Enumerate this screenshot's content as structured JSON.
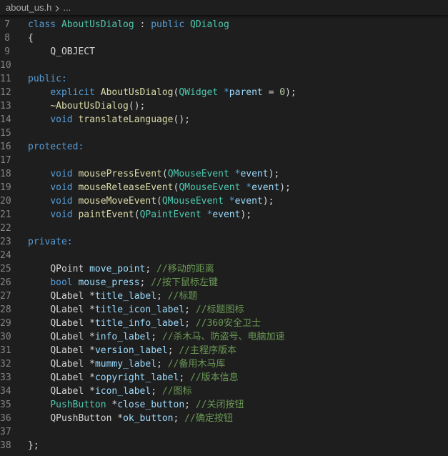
{
  "breadcrumb": {
    "file": "about_us.h",
    "more": "..."
  },
  "colors": {
    "background": "#1e1e1e",
    "keyword": "#569cd6",
    "type": "#4ec9b0",
    "function": "#dcdcaa",
    "variable": "#9cdcfe",
    "number": "#b5cea8",
    "comment": "#6a9955",
    "plain": "#d4d4d4",
    "line_number": "#858585"
  },
  "lines": [
    {
      "n": "7",
      "tokens": [
        [
          "kw",
          "class"
        ],
        [
          "pl",
          " "
        ],
        [
          "ty",
          "AboutUsDialog"
        ],
        [
          "pl",
          " : "
        ],
        [
          "kw",
          "public"
        ],
        [
          "pl",
          " "
        ],
        [
          "ty",
          "QDialog"
        ]
      ]
    },
    {
      "n": "8",
      "tokens": [
        [
          "pl",
          "{"
        ]
      ]
    },
    {
      "n": "9",
      "tokens": [
        [
          "pl",
          "    "
        ],
        [
          "pl",
          "Q_OBJECT"
        ]
      ]
    },
    {
      "n": "10",
      "tokens": []
    },
    {
      "n": "11",
      "tokens": [
        [
          "kw",
          "public:"
        ]
      ]
    },
    {
      "n": "12",
      "tokens": [
        [
          "pl",
          "    "
        ],
        [
          "kw",
          "explicit"
        ],
        [
          "pl",
          " "
        ],
        [
          "fn",
          "AboutUsDialog"
        ],
        [
          "pl",
          "("
        ],
        [
          "ty",
          "QWidget"
        ],
        [
          "pl",
          " "
        ],
        [
          "kw",
          "*"
        ],
        [
          "var",
          "parent"
        ],
        [
          "pl",
          " = "
        ],
        [
          "num",
          "0"
        ],
        [
          "pl",
          ");"
        ]
      ]
    },
    {
      "n": "13",
      "tokens": [
        [
          "pl",
          "    "
        ],
        [
          "fn",
          "~AboutUsDialog"
        ],
        [
          "pl",
          "();"
        ]
      ]
    },
    {
      "n": "14",
      "tokens": [
        [
          "pl",
          "    "
        ],
        [
          "kw",
          "void"
        ],
        [
          "pl",
          " "
        ],
        [
          "fn",
          "translateLanguage"
        ],
        [
          "pl",
          "();"
        ]
      ]
    },
    {
      "n": "15",
      "tokens": []
    },
    {
      "n": "16",
      "tokens": [
        [
          "kw",
          "protected:"
        ]
      ]
    },
    {
      "n": "17",
      "tokens": []
    },
    {
      "n": "18",
      "tokens": [
        [
          "pl",
          "    "
        ],
        [
          "kw",
          "void"
        ],
        [
          "pl",
          " "
        ],
        [
          "fn",
          "mousePressEvent"
        ],
        [
          "pl",
          "("
        ],
        [
          "ty",
          "QMouseEvent"
        ],
        [
          "pl",
          " "
        ],
        [
          "kw",
          "*"
        ],
        [
          "var",
          "event"
        ],
        [
          "pl",
          ");"
        ]
      ]
    },
    {
      "n": "19",
      "tokens": [
        [
          "pl",
          "    "
        ],
        [
          "kw",
          "void"
        ],
        [
          "pl",
          " "
        ],
        [
          "fn",
          "mouseReleaseEvent"
        ],
        [
          "pl",
          "("
        ],
        [
          "ty",
          "QMouseEvent"
        ],
        [
          "pl",
          " "
        ],
        [
          "kw",
          "*"
        ],
        [
          "var",
          "event"
        ],
        [
          "pl",
          ");"
        ]
      ]
    },
    {
      "n": "20",
      "tokens": [
        [
          "pl",
          "    "
        ],
        [
          "kw",
          "void"
        ],
        [
          "pl",
          " "
        ],
        [
          "fn",
          "mouseMoveEvent"
        ],
        [
          "pl",
          "("
        ],
        [
          "ty",
          "QMouseEvent"
        ],
        [
          "pl",
          " "
        ],
        [
          "kw",
          "*"
        ],
        [
          "var",
          "event"
        ],
        [
          "pl",
          ");"
        ]
      ]
    },
    {
      "n": "21",
      "tokens": [
        [
          "pl",
          "    "
        ],
        [
          "kw",
          "void"
        ],
        [
          "pl",
          " "
        ],
        [
          "fn",
          "paintEvent"
        ],
        [
          "pl",
          "("
        ],
        [
          "ty",
          "QPaintEvent"
        ],
        [
          "pl",
          " "
        ],
        [
          "kw",
          "*"
        ],
        [
          "var",
          "event"
        ],
        [
          "pl",
          ");"
        ]
      ]
    },
    {
      "n": "22",
      "tokens": []
    },
    {
      "n": "23",
      "tokens": [
        [
          "kw",
          "private:"
        ]
      ]
    },
    {
      "n": "24",
      "tokens": []
    },
    {
      "n": "25",
      "tokens": [
        [
          "pl",
          "    "
        ],
        [
          "pl",
          "QPoint"
        ],
        [
          "pl",
          " "
        ],
        [
          "var",
          "move_point"
        ],
        [
          "pl",
          "; "
        ],
        [
          "cm",
          "//移动的距离"
        ]
      ]
    },
    {
      "n": "26",
      "tokens": [
        [
          "pl",
          "    "
        ],
        [
          "kw",
          "bool"
        ],
        [
          "pl",
          " "
        ],
        [
          "var",
          "mouse_press"
        ],
        [
          "pl",
          "; "
        ],
        [
          "cm",
          "//按下鼠标左键"
        ]
      ]
    },
    {
      "n": "27",
      "tokens": [
        [
          "pl",
          "    "
        ],
        [
          "pl",
          "QLabel"
        ],
        [
          "pl",
          " *"
        ],
        [
          "var",
          "title_label"
        ],
        [
          "pl",
          "; "
        ],
        [
          "cm",
          "//标题"
        ]
      ]
    },
    {
      "n": "28",
      "tokens": [
        [
          "pl",
          "    "
        ],
        [
          "pl",
          "QLabel"
        ],
        [
          "pl",
          " *"
        ],
        [
          "var",
          "title_icon_label"
        ],
        [
          "pl",
          "; "
        ],
        [
          "cm",
          "//标题图标"
        ]
      ]
    },
    {
      "n": "29",
      "tokens": [
        [
          "pl",
          "    "
        ],
        [
          "pl",
          "QLabel"
        ],
        [
          "pl",
          " *"
        ],
        [
          "var",
          "title_info_label"
        ],
        [
          "pl",
          "; "
        ],
        [
          "cm",
          "//360安全卫士"
        ]
      ]
    },
    {
      "n": "30",
      "tokens": [
        [
          "pl",
          "    "
        ],
        [
          "pl",
          "QLabel"
        ],
        [
          "pl",
          " *"
        ],
        [
          "var",
          "info_label"
        ],
        [
          "pl",
          "; "
        ],
        [
          "cm",
          "//杀木马、防盗号、电脑加速"
        ]
      ]
    },
    {
      "n": "31",
      "tokens": [
        [
          "pl",
          "    "
        ],
        [
          "pl",
          "QLabel"
        ],
        [
          "pl",
          " *"
        ],
        [
          "var",
          "version_label"
        ],
        [
          "pl",
          "; "
        ],
        [
          "cm",
          "//主程序版本"
        ]
      ]
    },
    {
      "n": "32",
      "tokens": [
        [
          "pl",
          "    "
        ],
        [
          "pl",
          "QLabel"
        ],
        [
          "pl",
          " *"
        ],
        [
          "var",
          "mummy_label"
        ],
        [
          "pl",
          "; "
        ],
        [
          "cm",
          "//备用木马库"
        ]
      ]
    },
    {
      "n": "33",
      "tokens": [
        [
          "pl",
          "    "
        ],
        [
          "pl",
          "QLabel"
        ],
        [
          "pl",
          " *"
        ],
        [
          "var",
          "copyright_label"
        ],
        [
          "pl",
          "; "
        ],
        [
          "cm",
          "//版本信息"
        ]
      ]
    },
    {
      "n": "34",
      "tokens": [
        [
          "pl",
          "    "
        ],
        [
          "pl",
          "QLabel"
        ],
        [
          "pl",
          " *"
        ],
        [
          "var",
          "icon_label"
        ],
        [
          "pl",
          "; "
        ],
        [
          "cm",
          "//图标"
        ]
      ]
    },
    {
      "n": "35",
      "tokens": [
        [
          "pl",
          "    "
        ],
        [
          "ty",
          "PushButton"
        ],
        [
          "pl",
          " *"
        ],
        [
          "var",
          "close_button"
        ],
        [
          "pl",
          "; "
        ],
        [
          "cm",
          "//关闭按钮"
        ]
      ]
    },
    {
      "n": "36",
      "tokens": [
        [
          "pl",
          "    "
        ],
        [
          "pl",
          "QPushButton"
        ],
        [
          "pl",
          " *"
        ],
        [
          "var",
          "ok_button"
        ],
        [
          "pl",
          "; "
        ],
        [
          "cm",
          "//确定按钮"
        ]
      ]
    },
    {
      "n": "37",
      "tokens": []
    },
    {
      "n": "38",
      "tokens": [
        [
          "pl",
          "};"
        ]
      ]
    }
  ]
}
